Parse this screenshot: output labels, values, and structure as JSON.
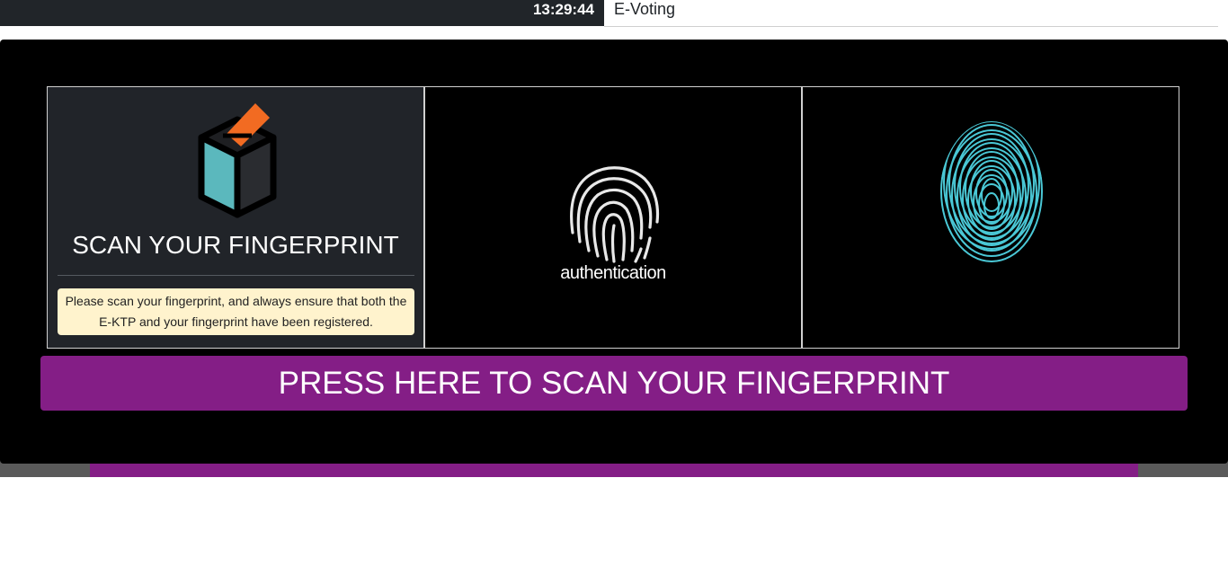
{
  "header": {
    "clock": "13:29:44",
    "app_title": "E-Voting"
  },
  "info_card": {
    "icon": "ballot-box-icon",
    "title": "SCAN YOUR FINGERPRINT",
    "notice": "Please scan your fingerprint, and always ensure that both the E-KTP and your fingerprint have been registered."
  },
  "auth_card": {
    "icon": "fingerprint-icon",
    "label": "authentication"
  },
  "scan_card": {
    "icon": "fingerprint-scan-icon"
  },
  "scan_button": {
    "label": "PRESS HERE TO SCAN YOUR FINGERPRINT"
  },
  "colors": {
    "accent_purple": "#841e86",
    "fingerprint_cyan": "#4fd3e2",
    "ballot_orange": "#f26b22",
    "ballot_teal": "#5bb8bd",
    "notice_bg": "#fff3cd"
  }
}
